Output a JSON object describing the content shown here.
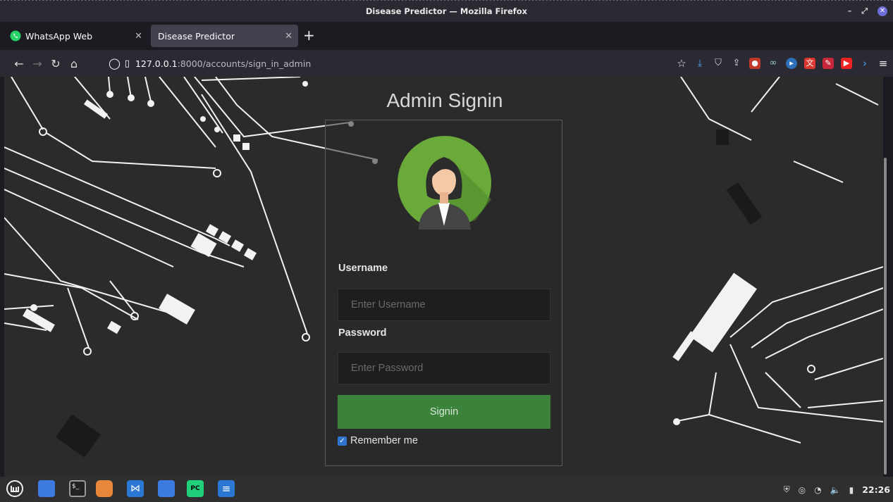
{
  "window": {
    "title": "Disease Predictor — Mozilla Firefox"
  },
  "tabs": [
    {
      "label": "WhatsApp Web",
      "icon": "whatsapp-icon"
    },
    {
      "label": "Disease Predictor",
      "icon": "none"
    }
  ],
  "url": {
    "host": "127.0.0.1",
    "path": ":8000/accounts/sign_in_admin"
  },
  "page": {
    "heading": "Admin Signin",
    "username_label": "Username",
    "username_placeholder": "Enter Username",
    "password_label": "Password",
    "password_placeholder": "Enter Password",
    "signin_label": "Signin",
    "remember_label": "Remember me",
    "remember_checked": true
  },
  "taskbar": {
    "clock": "22:26"
  },
  "colors": {
    "button": "#3b833b",
    "avatar_bg": "#6aaa3a",
    "checkbox": "#2f74d0"
  }
}
